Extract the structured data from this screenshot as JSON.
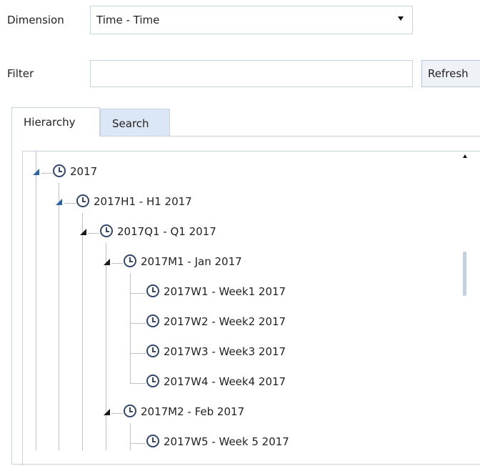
{
  "form": {
    "dimension_label": "Dimension",
    "dimension_value": "Time - Time",
    "filter_label": "Filter",
    "filter_value": "",
    "refresh_label": "Refresh"
  },
  "tabs": [
    {
      "label": "Hierarchy",
      "active": true
    },
    {
      "label": "Search",
      "active": false
    }
  ],
  "tree": {
    "nodes": [
      {
        "label": "2017",
        "level": 0,
        "expanded": true
      },
      {
        "label": "2017H1 - H1 2017",
        "level": 1,
        "expanded": true
      },
      {
        "label": "2017Q1 - Q1 2017",
        "level": 2,
        "expanded": true
      },
      {
        "label": "2017M1 - Jan 2017",
        "level": 3,
        "expanded": true
      },
      {
        "label": "2017W1 - Week1 2017",
        "level": 4
      },
      {
        "label": "2017W2 - Week2 2017",
        "level": 4
      },
      {
        "label": "2017W3 - Week3 2017",
        "level": 4
      },
      {
        "label": "2017W4 - Week4 2017",
        "level": 4
      },
      {
        "label": "2017M2 - Feb 2017",
        "level": 3,
        "expanded": true
      },
      {
        "label": "2017W5 - Week 5 2017",
        "level": 4
      }
    ]
  },
  "colors": {
    "expander_top_levels": "#2f62a8",
    "expander_lower_levels": "#1a1a1a",
    "active_tab_bg": "#ffffff",
    "inactive_tab_bg": "#dce7f5",
    "border": "#c7d3e3"
  },
  "icons": {
    "node_icon": "clock-icon",
    "expander_icon": "expanded-triangle-icon",
    "dropdown_icon": "chevron-down-icon"
  }
}
